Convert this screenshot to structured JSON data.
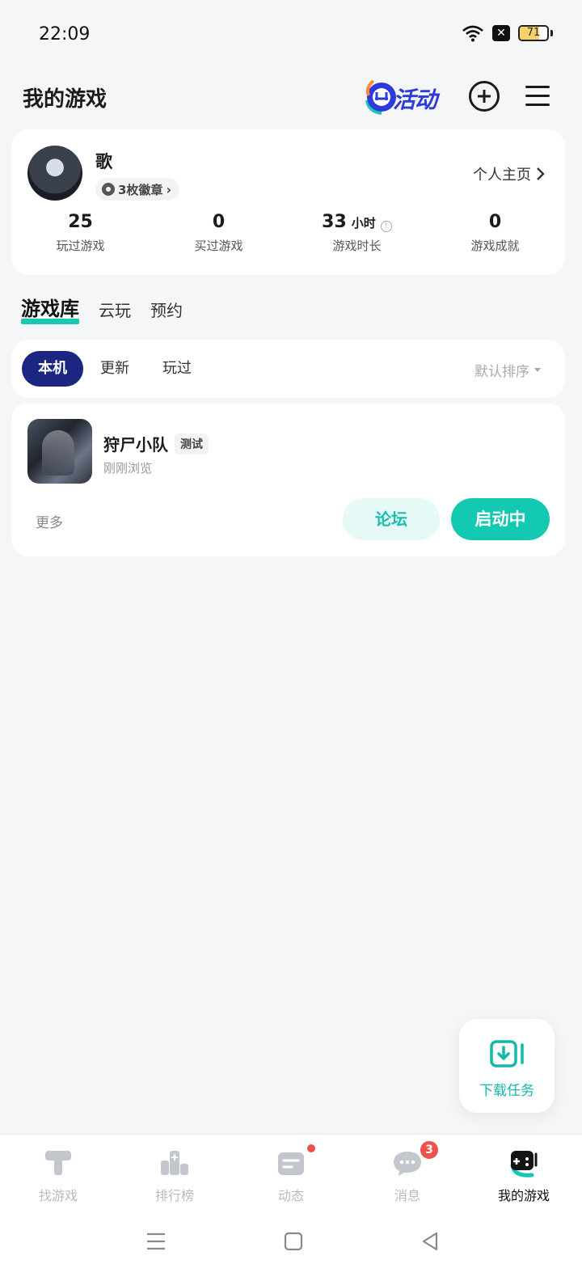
{
  "status_bar": {
    "time": "22:09",
    "battery": "71",
    "battery_level": 0.71
  },
  "header": {
    "title": "我的游戏",
    "activity_label": "活动"
  },
  "profile": {
    "name": "歌",
    "badges": "3枚徽章",
    "homepage_link": "个人主页",
    "stats": [
      {
        "value": "25",
        "unit": "",
        "label": "玩过游戏"
      },
      {
        "value": "0",
        "unit": "",
        "label": "买过游戏"
      },
      {
        "value": "33",
        "unit": "小时",
        "label": "游戏时长"
      },
      {
        "value": "0",
        "unit": "",
        "label": "游戏成就"
      }
    ]
  },
  "library_tabs": [
    "游戏库",
    "云玩",
    "预约"
  ],
  "filters": {
    "items": [
      "本机",
      "更新",
      "玩过"
    ],
    "sort": "默认排序"
  },
  "game": {
    "title": "狩尸小队",
    "tag": "测试",
    "subtitle": "刚刚浏览",
    "more": "更多",
    "forum_button": "论坛",
    "launch_button": "启动中"
  },
  "download_fab": {
    "label": "下载任务"
  },
  "bottom_nav": [
    {
      "label": "找游戏",
      "icon": "hammer-icon"
    },
    {
      "label": "排行榜",
      "icon": "ranking-icon"
    },
    {
      "label": "动态",
      "icon": "feed-icon",
      "badge": "dot"
    },
    {
      "label": "消息",
      "icon": "chat-icon",
      "badge": "3"
    },
    {
      "label": "我的游戏",
      "icon": "gamepad-icon",
      "active": true
    }
  ],
  "colors": {
    "accent": "#13c9b2",
    "filter_active": "#1d2583",
    "badge_red": "#f0504c"
  }
}
